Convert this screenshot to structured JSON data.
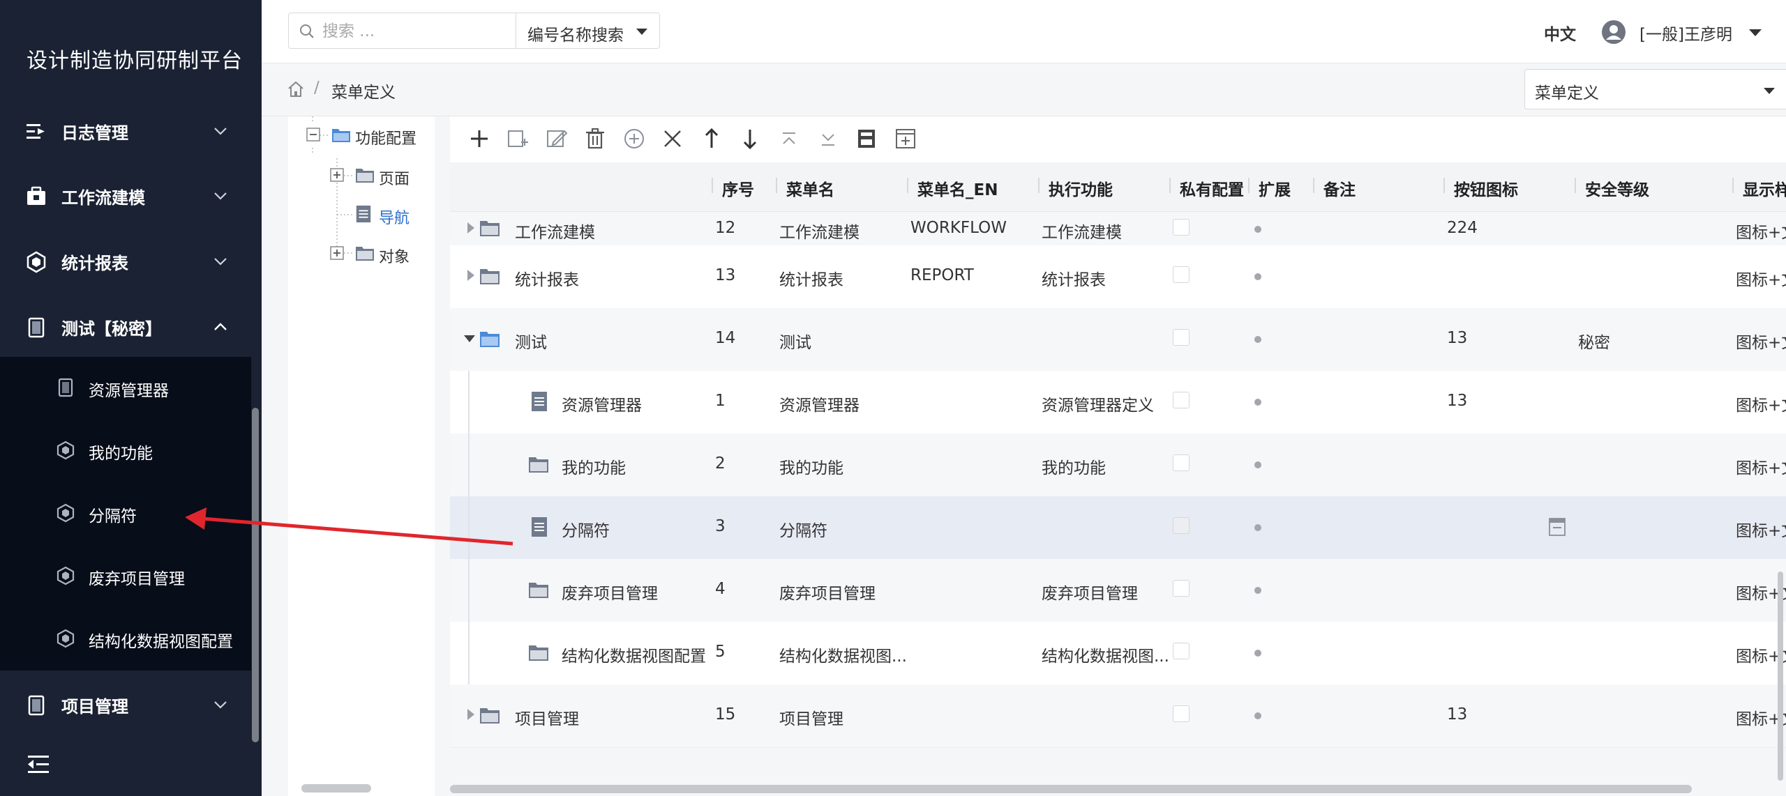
{
  "app": {
    "title": "设计制造协同研制平台"
  },
  "sidebar": {
    "items": [
      {
        "label": "日志管理",
        "icon": "log-icon",
        "expanded": false
      },
      {
        "label": "工作流建模",
        "icon": "workflow-icon",
        "expanded": false
      },
      {
        "label": "统计报表",
        "icon": "report-icon",
        "expanded": false
      },
      {
        "label": "测试【秘密】",
        "icon": "test-icon",
        "expanded": true
      },
      {
        "label": "项目管理",
        "icon": "project-icon",
        "expanded": false
      }
    ],
    "submenu": [
      {
        "label": "资源管理器",
        "icon": "document-icon"
      },
      {
        "label": "我的功能",
        "icon": "cube-icon"
      },
      {
        "label": "分隔符",
        "icon": "cube-icon"
      },
      {
        "label": "废弃项目管理",
        "icon": "cube-icon"
      },
      {
        "label": "结构化数据视图配置",
        "icon": "cube-icon"
      }
    ]
  },
  "topbar": {
    "search_placeholder": "搜索 ...",
    "search_mode": "编号名称搜索",
    "language": "中文",
    "user": "[一般]王彦明"
  },
  "breadcrumb": {
    "current": "菜单定义",
    "separator": "/"
  },
  "page_select": {
    "value": "菜单定义"
  },
  "tree": {
    "nodes": [
      {
        "label": "功能配置",
        "toggle": "minus",
        "level": 0
      },
      {
        "label": "页面",
        "toggle": "plus",
        "level": 1
      },
      {
        "label": "导航",
        "toggle": "none",
        "level": 1,
        "selected": true
      },
      {
        "label": "对象",
        "toggle": "plus",
        "level": 1
      }
    ]
  },
  "grid": {
    "columns": [
      "序号",
      "菜单名",
      "菜单名_EN",
      "执行功能",
      "私有配置",
      "扩展",
      "备注",
      "按钮图标",
      "安全等级",
      "显示样"
    ],
    "rows": [
      {
        "name": "工作流建模",
        "seq": "12",
        "menu_name": "工作流建模",
        "menu_name_en": "WORKFLOW",
        "function": "工作流建模",
        "icon_no": "224",
        "security": "",
        "display": "图标+文",
        "type": "folder",
        "expand": "right"
      },
      {
        "name": "统计报表",
        "seq": "13",
        "menu_name": "统计报表",
        "menu_name_en": "REPORT",
        "function": "统计报表",
        "icon_no": "",
        "security": "",
        "display": "图标+文",
        "type": "folder",
        "expand": "right"
      },
      {
        "name": "测试",
        "seq": "14",
        "menu_name": "测试",
        "menu_name_en": "",
        "function": "",
        "icon_no": "13",
        "security": "秘密",
        "display": "图标+文",
        "type": "folder-open",
        "expand": "down"
      },
      {
        "name": "资源管理器",
        "seq": "1",
        "menu_name": "资源管理器",
        "menu_name_en": "",
        "function": "资源管理器定义",
        "icon_no": "13",
        "security": "",
        "display": "图标+文",
        "type": "doc",
        "expand": "none"
      },
      {
        "name": "我的功能",
        "seq": "2",
        "menu_name": "我的功能",
        "menu_name_en": "",
        "function": "我的功能",
        "icon_no": "",
        "security": "",
        "display": "图标+文",
        "type": "folder",
        "expand": "none"
      },
      {
        "name": "分隔符",
        "seq": "3",
        "menu_name": "分隔符",
        "menu_name_en": "",
        "function": "",
        "icon_no": "",
        "security": "",
        "display": "图标+文",
        "type": "doc",
        "expand": "none",
        "selected": true
      },
      {
        "name": "废弃项目管理",
        "seq": "4",
        "menu_name": "废弃项目管理",
        "menu_name_en": "",
        "function": "废弃项目管理",
        "icon_no": "",
        "security": "",
        "display": "图标+文",
        "type": "folder",
        "expand": "none"
      },
      {
        "name": "结构化数据视图配置",
        "seq": "5",
        "menu_name": "结构化数据视图...",
        "menu_name_en": "",
        "function": "结构化数据视图...",
        "icon_no": "",
        "security": "",
        "display": "图标+文",
        "type": "folder",
        "expand": "none"
      },
      {
        "name": "项目管理",
        "seq": "15",
        "menu_name": "项目管理",
        "menu_name_en": "",
        "function": "",
        "icon_no": "13",
        "security": "",
        "display": "图标+文",
        "type": "folder",
        "expand": "right"
      }
    ]
  },
  "toolbar": {
    "buttons": [
      "add-icon",
      "add-child-icon",
      "edit-icon",
      "delete-icon",
      "add-circle-icon",
      "close-icon",
      "move-up-icon",
      "move-down-icon",
      "move-top-icon",
      "move-bottom-icon",
      "save-icon",
      "add-box-icon"
    ]
  },
  "colors": {
    "sidebar_bg": "#1a2233",
    "submenu_bg": "#070d19",
    "arrow": "#e0262c",
    "folder": "#6f7a8c",
    "folder_open": "#4a8ad8"
  }
}
